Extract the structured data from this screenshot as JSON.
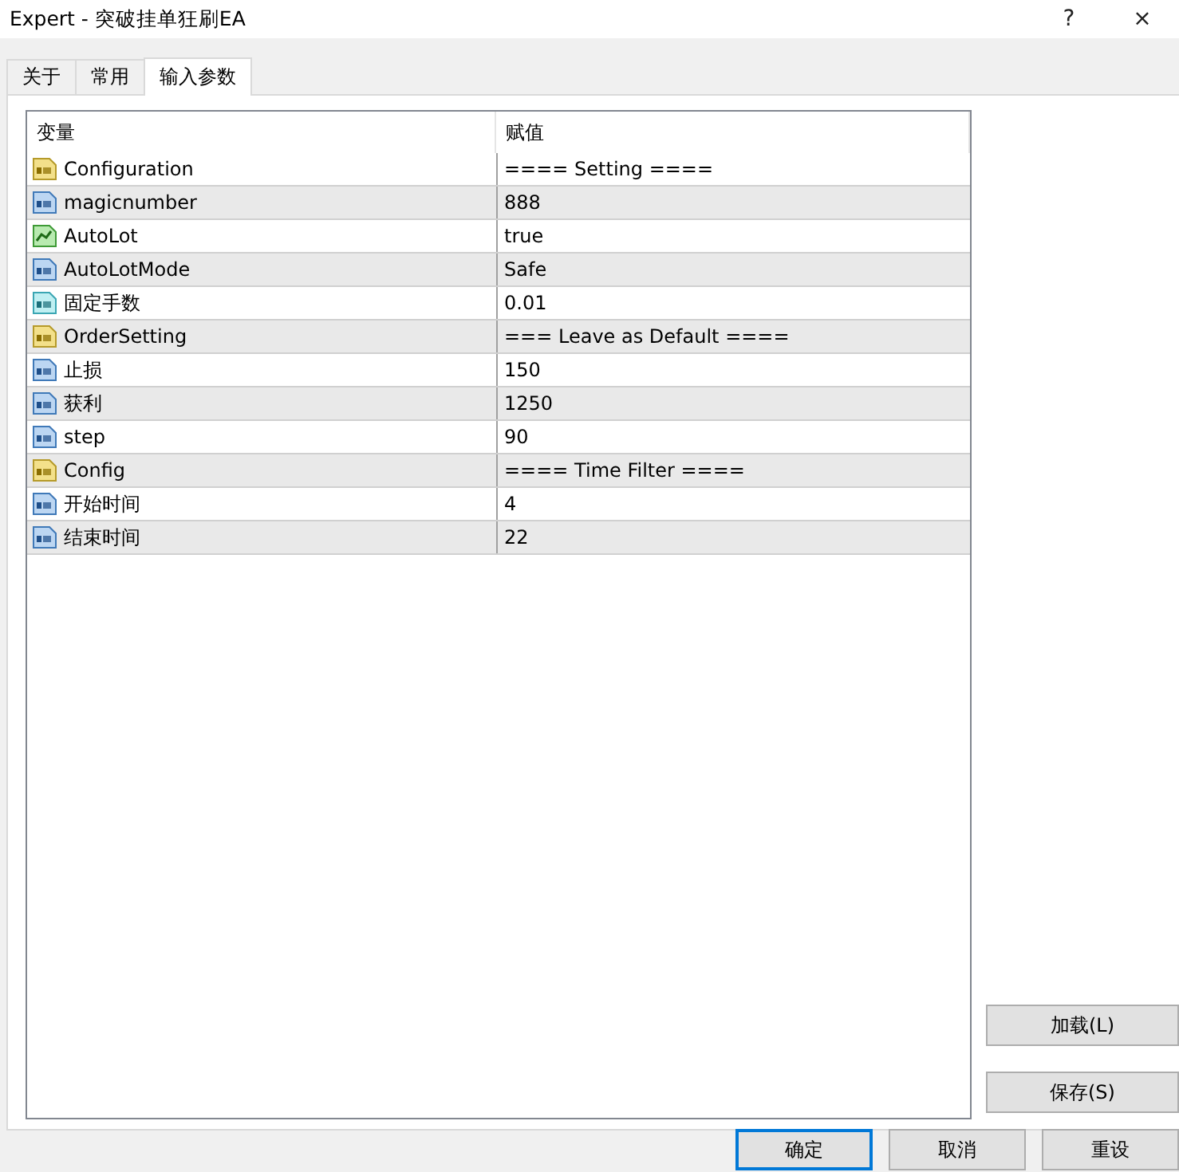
{
  "window": {
    "title": "Expert - 突破挂单狂刷EA",
    "help": "?",
    "close": "×"
  },
  "tabs": [
    {
      "label": "关于",
      "selected": false
    },
    {
      "label": "常用",
      "selected": false
    },
    {
      "label": "输入参数",
      "selected": true
    }
  ],
  "table": {
    "columns": [
      "变量",
      "赋值"
    ],
    "rows": [
      {
        "kind": "string",
        "name": "Configuration",
        "value": "==== Setting ===="
      },
      {
        "kind": "integer",
        "name": "magicnumber",
        "value": "888"
      },
      {
        "kind": "boolean",
        "name": "AutoLot",
        "value": "true"
      },
      {
        "kind": "integer",
        "name": "AutoLotMode",
        "value": "Safe"
      },
      {
        "kind": "double",
        "name": "固定手数",
        "value": "0.01"
      },
      {
        "kind": "string",
        "name": "OrderSetting",
        "value": "=== Leave as Default ===="
      },
      {
        "kind": "integer",
        "name": "止损",
        "value": "150"
      },
      {
        "kind": "integer",
        "name": "获利",
        "value": "1250"
      },
      {
        "kind": "integer",
        "name": "step",
        "value": "90"
      },
      {
        "kind": "string",
        "name": "Config",
        "value": "==== Time Filter ===="
      },
      {
        "kind": "integer",
        "name": "开始时间",
        "value": "4"
      },
      {
        "kind": "integer",
        "name": "结束时间",
        "value": "22"
      }
    ]
  },
  "side_buttons": [
    "加载(L)",
    "保存(S)"
  ],
  "buttons": [
    {
      "label": "确定",
      "focused": true
    },
    {
      "label": "取消",
      "focused": false
    },
    {
      "label": "重设",
      "focused": false
    }
  ]
}
